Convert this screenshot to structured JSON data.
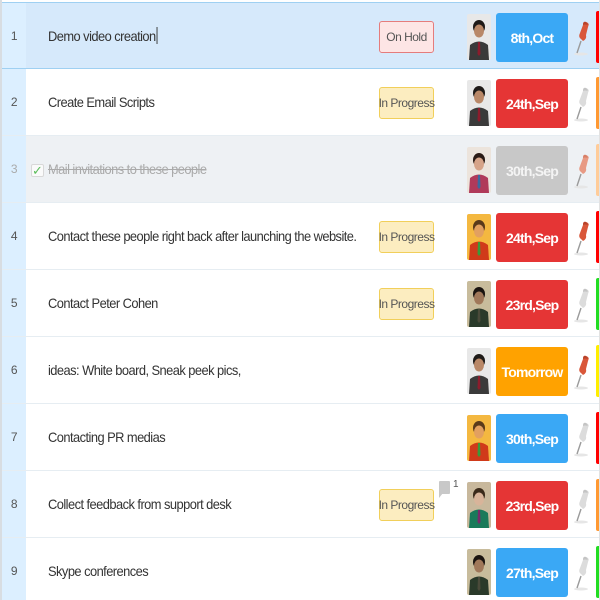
{
  "colors": {
    "date_blue": "#3aa8f5",
    "date_red": "#e53535",
    "date_gray": "#c8c8c8",
    "date_orange": "#ffa200",
    "prio_red": "#ff0000",
    "prio_orange": "#ff9933",
    "prio_light_orange": "#ffcc99",
    "prio_green": "#22dd22",
    "prio_yellow": "#ffee00"
  },
  "tasks": [
    {
      "num": "1",
      "title": "Demo video creation",
      "status": "On Hold",
      "status_type": "hold",
      "avatar": "man-suit",
      "date": "8th,Oct",
      "date_color": "blue",
      "pinned": true,
      "priority": "red",
      "selected": true,
      "done": false,
      "comments": null
    },
    {
      "num": "2",
      "title": "Create Email Scripts",
      "status": "In Progress",
      "status_type": "progress",
      "avatar": "man-suit",
      "date": "24th,Sep",
      "date_color": "red",
      "pinned": false,
      "priority": "orange",
      "selected": false,
      "done": false,
      "comments": null
    },
    {
      "num": "3",
      "title": "Mail invitations to these people",
      "status": "",
      "status_type": "",
      "avatar": "woman-scarf",
      "date": "30th,Sep",
      "date_color": "gray",
      "pinned": true,
      "priority": "light_orange",
      "selected": false,
      "done": true,
      "comments": null
    },
    {
      "num": "4",
      "title": "Contact these people right back after launching the website.",
      "status": "In Progress",
      "status_type": "progress",
      "avatar": "man-sunny",
      "date": "24th,Sep",
      "date_color": "red",
      "pinned": true,
      "priority": "red",
      "selected": false,
      "done": false,
      "comments": null
    },
    {
      "num": "5",
      "title": "Contact Peter Cohen",
      "status": "In Progress",
      "status_type": "progress",
      "avatar": "man-dark",
      "date": "23rd,Sep",
      "date_color": "red",
      "pinned": false,
      "priority": "green",
      "selected": false,
      "done": false,
      "comments": null
    },
    {
      "num": "6",
      "title": "ideas: White board, Sneak peek pics,",
      "status": "",
      "status_type": "",
      "avatar": "man-suit",
      "date": "Tomorrow",
      "date_color": "orange",
      "pinned": true,
      "priority": "yellow",
      "selected": false,
      "done": false,
      "comments": null
    },
    {
      "num": "7",
      "title": "Contacting PR medias",
      "status": "",
      "status_type": "",
      "avatar": "man-sunny",
      "date": "30th,Sep",
      "date_color": "blue",
      "pinned": false,
      "priority": "red",
      "selected": false,
      "done": false,
      "comments": null
    },
    {
      "num": "8",
      "title": "Collect feedback from support desk",
      "status": "In Progress",
      "status_type": "progress",
      "avatar": "woman-green",
      "date": "23rd,Sep",
      "date_color": "red",
      "pinned": false,
      "priority": "orange",
      "selected": false,
      "done": false,
      "comments": "1"
    },
    {
      "num": "9",
      "title": "Skype conferences",
      "status": "",
      "status_type": "",
      "avatar": "man-dark",
      "date": "27th,Sep",
      "date_color": "blue",
      "pinned": false,
      "priority": "green",
      "selected": false,
      "done": false,
      "comments": null
    }
  ],
  "icons": {
    "checkbox_checked": "✓",
    "pin": "pushpin-icon",
    "comment": "comment-icon"
  }
}
